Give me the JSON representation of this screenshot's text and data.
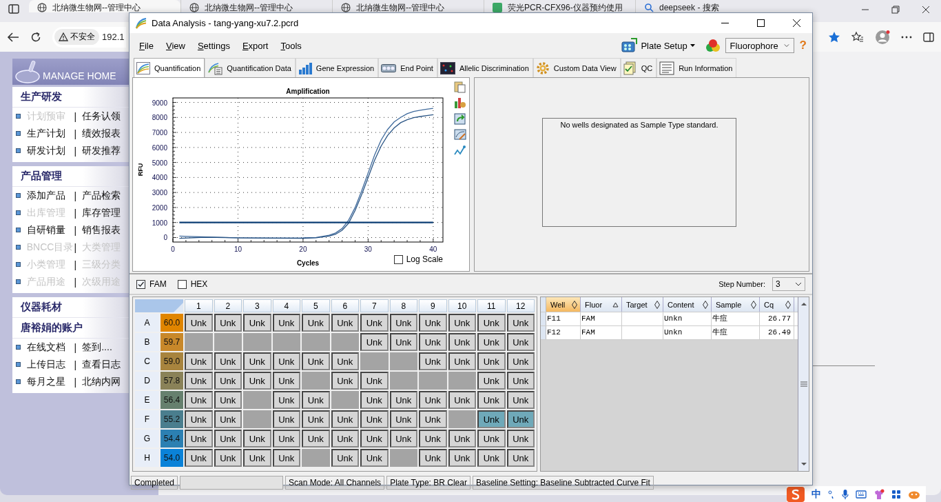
{
  "browser": {
    "tabs": [
      {
        "title": "北纳微生物网--管理中心",
        "kind": "globe",
        "selected": true
      },
      {
        "title": "北纳微生物网--管理中心",
        "kind": "globe",
        "selected": false
      },
      {
        "title": "北纳微生物网--管理中心",
        "kind": "globe",
        "selected": false
      },
      {
        "title": "荧光PCR-CFX96-仪器预约使用",
        "kind": "site",
        "selected": false
      },
      {
        "title": "deepseek - 搜索",
        "kind": "search",
        "selected": false
      }
    ],
    "address": {
      "security": "不安全",
      "url": "192.1"
    }
  },
  "sidebar": {
    "logo": "MANAGE HOME",
    "groups": [
      {
        "sections": [
          {
            "title": "生产研发",
            "links": [
              {
                "left": {
                  "label": "计划预审",
                  "disabled": true
                },
                "separator": "|",
                "right": {
                  "label": "任务认领",
                  "disabled": false
                }
              },
              {
                "left": {
                  "label": "生产计划",
                  "disabled": false
                },
                "separator": "|",
                "right": {
                  "label": "绩效报表",
                  "disabled": false
                }
              },
              {
                "left": {
                  "label": "研发计划",
                  "disabled": false
                },
                "separator": "|",
                "right": {
                  "label": "研发推荐",
                  "disabled": false
                }
              }
            ]
          }
        ]
      },
      {
        "sections": [
          {
            "title": "产品管理",
            "links": [
              {
                "left": {
                  "label": "添加产品",
                  "disabled": false
                },
                "separator": "|",
                "right": {
                  "label": "产品检索",
                  "disabled": false
                }
              },
              {
                "left": {
                  "label": "出库管理",
                  "disabled": true
                },
                "separator": "|",
                "right": {
                  "label": "库存管理",
                  "disabled": false
                }
              },
              {
                "left": {
                  "label": "自研销量",
                  "disabled": false
                },
                "separator": "|",
                "right": {
                  "label": "销售报表",
                  "disabled": false
                }
              },
              {
                "left": {
                  "label": "BNCC目录",
                  "disabled": true
                },
                "separator": "|",
                "right": {
                  "label": "大类管理",
                  "disabled": true
                }
              },
              {
                "left": {
                  "label": "小类管理",
                  "disabled": true
                },
                "separator": "|",
                "right": {
                  "label": "三级分类",
                  "disabled": true
                }
              },
              {
                "left": {
                  "label": "产品用途",
                  "disabled": true
                },
                "separator": "|",
                "right": {
                  "label": "次级用途",
                  "disabled": true
                }
              }
            ]
          }
        ]
      },
      {
        "sections": [
          {
            "title": "仪器耗材"
          },
          {
            "title": "唐裕娟的账户",
            "links": [
              {
                "left": {
                  "label": "在线文档",
                  "disabled": false
                },
                "separator": "|",
                "right": {
                  "label": "签到....",
                  "disabled": false
                }
              },
              {
                "left": {
                  "label": "上传日志",
                  "disabled": false
                },
                "separator": "|",
                "right": {
                  "label": "查看日志",
                  "disabled": false
                }
              },
              {
                "left": {
                  "label": "每月之星",
                  "disabled": false
                },
                "separator": "|",
                "right": {
                  "label": "北纳内网",
                  "disabled": false
                }
              }
            ]
          }
        ]
      }
    ]
  },
  "window": {
    "title": "Data Analysis - tang-yang-xu7.2.pcrd"
  },
  "menu": [
    "File",
    "View",
    "Settings",
    "Export",
    "Tools"
  ],
  "toolbar": {
    "plate_setup": "Plate Setup",
    "fluorophore": "Fluorophore",
    "help": "?"
  },
  "tabs": [
    {
      "label": "Quantification",
      "kind": "amplification",
      "selected": true
    },
    {
      "label": "Quantification Data",
      "kind": "data",
      "selected": false
    },
    {
      "label": "Gene Expression",
      "kind": "bars",
      "selected": false
    },
    {
      "label": "End Point",
      "kind": "endpoint",
      "selected": false
    },
    {
      "label": "Allelic Discrimination",
      "kind": "allelic",
      "selected": false
    },
    {
      "label": "Custom Data View",
      "kind": "gear",
      "selected": false
    },
    {
      "label": "QC",
      "kind": "qc",
      "selected": false
    },
    {
      "label": "Run Information",
      "kind": "info",
      "selected": false
    }
  ],
  "amplification": {
    "chart_data": {
      "type": "line",
      "title": "Amplification",
      "xlabel": "Cycles",
      "ylabel": "RFU",
      "x": [
        1,
        5,
        10,
        15,
        20,
        22,
        24,
        25,
        26,
        27,
        28,
        29,
        30,
        31,
        32,
        33,
        34,
        35,
        36,
        37,
        38,
        39,
        40
      ],
      "series": [
        {
          "color": "#3f6a9c",
          "values": [
            100,
            40,
            -20,
            -30,
            -20,
            10,
            150,
            300,
            600,
            1150,
            2000,
            3100,
            4300,
            5500,
            6500,
            7200,
            7700,
            8000,
            8250,
            8400,
            8480,
            8550,
            8600
          ]
        },
        {
          "color": "#2a5585",
          "values": [
            -50,
            20,
            -20,
            -40,
            -50,
            -20,
            100,
            220,
            480,
            950,
            1800,
            2850,
            4000,
            5150,
            6100,
            6800,
            7300,
            7650,
            7850,
            7980,
            8060,
            8120,
            8180
          ]
        },
        {
          "color": "#0b3d73",
          "values": [
            1000,
            1000,
            1000,
            1000,
            1000,
            1000,
            1000,
            1000,
            1000,
            1000,
            1000,
            1000,
            1000,
            1000,
            1000,
            1000,
            1000,
            1000,
            1000,
            1000,
            1000,
            1000,
            1000
          ]
        }
      ],
      "grid": true,
      "xlim": [
        0,
        41.5
      ],
      "ylim": [
        -300,
        9300
      ],
      "xticks": [
        0,
        10,
        20,
        30,
        40
      ],
      "yticks": [
        0,
        1000,
        2000,
        3000,
        4000,
        5000,
        6000,
        7000,
        8000,
        9000
      ]
    },
    "log_scale": {
      "label": "Log Scale",
      "checked": false
    }
  },
  "standard_curve": {
    "message": "No wells designated as Sample Type standard."
  },
  "fluors": [
    {
      "label": "FAM",
      "checked": true
    },
    {
      "label": "HEX",
      "checked": false
    }
  ],
  "step": {
    "label": "Step Number:",
    "value": "3"
  },
  "plate": {
    "columns": [
      "1",
      "2",
      "3",
      "4",
      "5",
      "6",
      "7",
      "8",
      "9",
      "10",
      "11",
      "12"
    ],
    "rows": [
      {
        "label": "A",
        "temp": "60.0",
        "color": "#e08500",
        "wells": [
          {
            "kind": "unk",
            "label": "Unk",
            "selected": false
          },
          {
            "kind": "unk",
            "label": "Unk",
            "selected": false
          },
          {
            "kind": "unk",
            "label": "Unk",
            "selected": false
          },
          {
            "kind": "unk",
            "label": "Unk",
            "selected": false
          },
          {
            "kind": "unk",
            "label": "Unk",
            "selected": false
          },
          {
            "kind": "unk",
            "label": "Unk",
            "selected": false
          },
          {
            "kind": "unk",
            "label": "Unk",
            "selected": false
          },
          {
            "kind": "unk",
            "label": "Unk",
            "selected": false
          },
          {
            "kind": "unk",
            "label": "Unk",
            "selected": false
          },
          {
            "kind": "unk",
            "label": "Unk",
            "selected": false
          },
          {
            "kind": "unk",
            "label": "Unk",
            "selected": false
          },
          {
            "kind": "unk",
            "label": "Unk",
            "selected": false
          }
        ]
      },
      {
        "label": "B",
        "temp": "59.7",
        "color": "#c8882a",
        "wells": [
          {
            "kind": "empty",
            "selected": false
          },
          {
            "kind": "empty",
            "selected": false
          },
          {
            "kind": "empty",
            "selected": false
          },
          {
            "kind": "empty",
            "selected": false
          },
          {
            "kind": "empty",
            "selected": false
          },
          {
            "kind": "empty",
            "selected": false
          },
          {
            "kind": "unk",
            "label": "Unk",
            "selected": false
          },
          {
            "kind": "unk",
            "label": "Unk",
            "selected": false
          },
          {
            "kind": "unk",
            "label": "Unk",
            "selected": false
          },
          {
            "kind": "unk",
            "label": "Unk",
            "selected": false
          },
          {
            "kind": "unk",
            "label": "Unk",
            "selected": false
          },
          {
            "kind": "unk",
            "label": "Unk",
            "selected": false
          }
        ]
      },
      {
        "label": "C",
        "temp": "59.0",
        "color": "#a8843e",
        "wells": [
          {
            "kind": "unk",
            "label": "Unk",
            "selected": false
          },
          {
            "kind": "unk",
            "label": "Unk",
            "selected": false
          },
          {
            "kind": "unk",
            "label": "Unk",
            "selected": false
          },
          {
            "kind": "unk",
            "label": "Unk",
            "selected": false
          },
          {
            "kind": "unk",
            "label": "Unk",
            "selected": false
          },
          {
            "kind": "unk",
            "label": "Unk",
            "selected": false
          },
          {
            "kind": "empty",
            "selected": false
          },
          {
            "kind": "empty",
            "selected": false
          },
          {
            "kind": "unk",
            "label": "Unk",
            "selected": false
          },
          {
            "kind": "unk",
            "label": "Unk",
            "selected": false
          },
          {
            "kind": "unk",
            "label": "Unk",
            "selected": false
          },
          {
            "kind": "unk",
            "label": "Unk",
            "selected": false
          }
        ]
      },
      {
        "label": "D",
        "temp": "57.8",
        "color": "#8a8258",
        "wells": [
          {
            "kind": "unk",
            "label": "Unk",
            "selected": false
          },
          {
            "kind": "unk",
            "label": "Unk",
            "selected": false
          },
          {
            "kind": "unk",
            "label": "Unk",
            "selected": false
          },
          {
            "kind": "unk",
            "label": "Unk",
            "selected": false
          },
          {
            "kind": "empty",
            "selected": false
          },
          {
            "kind": "unk",
            "label": "Unk",
            "selected": false
          },
          {
            "kind": "unk",
            "label": "Unk",
            "selected": false
          },
          {
            "kind": "empty",
            "selected": false
          },
          {
            "kind": "empty",
            "selected": false
          },
          {
            "kind": "empty",
            "selected": false
          },
          {
            "kind": "unk",
            "label": "Unk",
            "selected": false
          },
          {
            "kind": "unk",
            "label": "Unk",
            "selected": false
          }
        ]
      },
      {
        "label": "E",
        "temp": "56.4",
        "color": "#66806e",
        "wells": [
          {
            "kind": "unk",
            "label": "Unk",
            "selected": false
          },
          {
            "kind": "unk",
            "label": "Unk",
            "selected": false
          },
          {
            "kind": "empty",
            "selected": false
          },
          {
            "kind": "unk",
            "label": "Unk",
            "selected": false
          },
          {
            "kind": "unk",
            "label": "Unk",
            "selected": false
          },
          {
            "kind": "empty",
            "selected": false
          },
          {
            "kind": "unk",
            "label": "Unk",
            "selected": false
          },
          {
            "kind": "unk",
            "label": "Unk",
            "selected": false
          },
          {
            "kind": "unk",
            "label": "Unk",
            "selected": false
          },
          {
            "kind": "unk",
            "label": "Unk",
            "selected": false
          },
          {
            "kind": "unk",
            "label": "Unk",
            "selected": false
          },
          {
            "kind": "unk",
            "label": "Unk",
            "selected": false
          }
        ]
      },
      {
        "label": "F",
        "temp": "55.2",
        "color": "#4a7e8e",
        "wells": [
          {
            "kind": "unk",
            "label": "Unk",
            "selected": false
          },
          {
            "kind": "unk",
            "label": "Unk",
            "selected": false
          },
          {
            "kind": "empty",
            "selected": false
          },
          {
            "kind": "unk",
            "label": "Unk",
            "selected": false
          },
          {
            "kind": "unk",
            "label": "Unk",
            "selected": false
          },
          {
            "kind": "unk",
            "label": "Unk",
            "selected": false
          },
          {
            "kind": "unk",
            "label": "Unk",
            "selected": false
          },
          {
            "kind": "unk",
            "label": "Unk",
            "selected": false
          },
          {
            "kind": "unk",
            "label": "Unk",
            "selected": false
          },
          {
            "kind": "empty",
            "selected": false
          },
          {
            "kind": "unk",
            "label": "Unk",
            "selected": true
          },
          {
            "kind": "unk",
            "label": "Unk",
            "selected": true
          }
        ]
      },
      {
        "label": "G",
        "temp": "54.4",
        "color": "#2c80b2",
        "wells": [
          {
            "kind": "unk",
            "label": "Unk",
            "selected": false
          },
          {
            "kind": "unk",
            "label": "Unk",
            "selected": false
          },
          {
            "kind": "unk",
            "label": "Unk",
            "selected": false
          },
          {
            "kind": "unk",
            "label": "Unk",
            "selected": false
          },
          {
            "kind": "unk",
            "label": "Unk",
            "selected": false
          },
          {
            "kind": "unk",
            "label": "Unk",
            "selected": false
          },
          {
            "kind": "unk",
            "label": "Unk",
            "selected": false
          },
          {
            "kind": "unk",
            "label": "Unk",
            "selected": false
          },
          {
            "kind": "unk",
            "label": "Unk",
            "selected": false
          },
          {
            "kind": "unk",
            "label": "Unk",
            "selected": false
          },
          {
            "kind": "unk",
            "label": "Unk",
            "selected": false
          },
          {
            "kind": "unk",
            "label": "Unk",
            "selected": false
          }
        ]
      },
      {
        "label": "H",
        "temp": "54.0",
        "color": "#0a82d8",
        "wells": [
          {
            "kind": "unk",
            "label": "Unk",
            "selected": false
          },
          {
            "kind": "unk",
            "label": "Unk",
            "selected": false
          },
          {
            "kind": "unk",
            "label": "Unk",
            "selected": false
          },
          {
            "kind": "unk",
            "label": "Unk",
            "selected": false
          },
          {
            "kind": "empty",
            "selected": false
          },
          {
            "kind": "unk",
            "label": "Unk",
            "selected": false
          },
          {
            "kind": "unk",
            "label": "Unk",
            "selected": false
          },
          {
            "kind": "empty",
            "selected": false
          },
          {
            "kind": "unk",
            "label": "Unk",
            "selected": false
          },
          {
            "kind": "unk",
            "label": "Unk",
            "selected": false
          },
          {
            "kind": "unk",
            "label": "Unk",
            "selected": false
          },
          {
            "kind": "unk",
            "label": "Unk",
            "selected": false
          }
        ]
      }
    ]
  },
  "results": {
    "columns": [
      {
        "label": "Well",
        "sorted_ascending": false,
        "selected": true
      },
      {
        "label": "Fluor",
        "sorted_ascending": true,
        "selected": false
      },
      {
        "label": "Target",
        "sorted_ascending": false,
        "selected": false
      },
      {
        "label": "Content",
        "sorted_ascending": false,
        "selected": false
      },
      {
        "label": "Sample",
        "sorted_ascending": false,
        "selected": false
      },
      {
        "label": "Cq",
        "sorted_ascending": false,
        "selected": false
      }
    ],
    "rows": [
      {
        "well": "F11",
        "fluor": "FAM",
        "content": "Unkn",
        "sample": "牛痘",
        "cq": "26.77"
      },
      {
        "well": "F12",
        "fluor": "FAM",
        "content": "Unkn",
        "sample": "牛痘",
        "cq": "26.49"
      }
    ]
  },
  "status_bar": {
    "state": "Completed",
    "scan_mode": "Scan Mode: All Channels",
    "plate_type": "Plate Type: BR Clear",
    "baseline": "Baseline Setting: Baseline Subtracted Curve Fit"
  },
  "ime": {
    "mode": "中"
  }
}
